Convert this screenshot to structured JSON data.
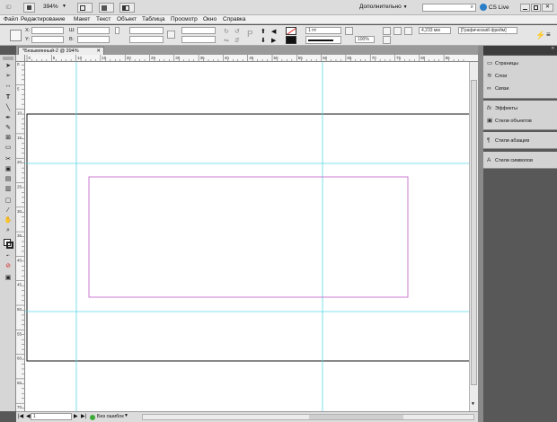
{
  "app": {
    "logo": "ID",
    "zoom": "394%",
    "workspace": "Дополнительно",
    "search_placeholder": "",
    "cs_live": "CS Live",
    "colors": {
      "chrome": "#dcdcdc",
      "panel_dark": "#585858",
      "guide": "#5ad8e6",
      "margin": "#c86ccf"
    }
  },
  "menu": [
    "Файл",
    "Редактирование",
    "Макет",
    "Текст",
    "Объект",
    "Таблица",
    "Просмотр",
    "Окно",
    "Справка"
  ],
  "control": {
    "x_label": "X:",
    "y_label": "Y:",
    "w_label": "Ш:",
    "h_label": "В:",
    "x_value": "",
    "y_value": "",
    "w_value": "",
    "h_value": "",
    "stroke_weight": "1 пт",
    "opacity": "100%",
    "dimension": "4,233 мм",
    "frame_style": "[Графический фрейм]"
  },
  "document": {
    "tab_title": "*Безымянный-2 @ 394%"
  },
  "ruler": {
    "h_labels": [
      "0",
      "5",
      "10",
      "15",
      "20",
      "25",
      "30",
      "35",
      "40",
      "45",
      "50",
      "55",
      "60",
      "65",
      "70",
      "75",
      "80",
      "85"
    ],
    "v_labels": [
      "0",
      "5",
      "10",
      "15",
      "20",
      "25",
      "30",
      "35",
      "40",
      "45",
      "50",
      "55",
      "60",
      "65",
      "70",
      "75"
    ]
  },
  "status": {
    "page": "1",
    "preflight": "Без ошибок"
  },
  "panels": [
    {
      "icon": "pages-icon",
      "glyph": "▭",
      "label": "Страницы"
    },
    {
      "icon": "layers-icon",
      "glyph": "≋",
      "label": "Слои"
    },
    {
      "icon": "links-icon",
      "glyph": "∞",
      "label": "Связи"
    },
    {
      "icon": "effects-icon",
      "glyph": "fx",
      "label": "Эффекты"
    },
    {
      "icon": "object-styles-icon",
      "glyph": "▣",
      "label": "Стили объектов"
    },
    {
      "icon": "paragraph-styles-icon",
      "glyph": "¶",
      "label": "Стили абзацев"
    },
    {
      "icon": "character-styles-icon",
      "glyph": "A",
      "label": "Стили символов"
    }
  ]
}
